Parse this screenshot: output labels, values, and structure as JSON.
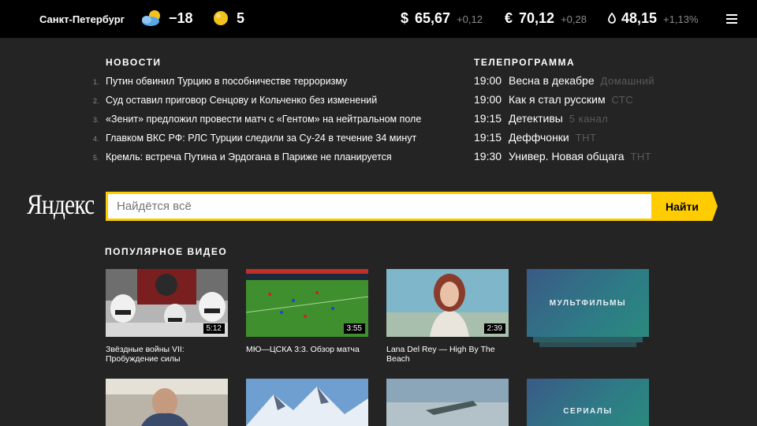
{
  "header": {
    "city": "Санкт-Петербург",
    "temperature": "−18",
    "traffic_score": "5",
    "rates": [
      {
        "symbol": "$",
        "value": "65,67",
        "change": "+0,12"
      },
      {
        "symbol": "€",
        "value": "70,12",
        "change": "+0,28"
      },
      {
        "symbol": "",
        "value": "48,15",
        "change": "+1,13%"
      }
    ],
    "weather_icon": "partly-cloudy-icon",
    "traffic_icon": "traffic-light-icon",
    "oil_icon": "oil-drop-icon",
    "menu_icon": "hamburger-menu-icon"
  },
  "news": {
    "title": "НОВОСТИ",
    "items": [
      {
        "num": "1.",
        "text": "Путин обвинил Турцию в пособничестве терроризму"
      },
      {
        "num": "2.",
        "text": "Суд оставил приговор Сенцову и Кольченко без изменений"
      },
      {
        "num": "3.",
        "text": "«Зенит» предложил провести матч с «Гентом» на нейтральном поле"
      },
      {
        "num": "4.",
        "text": "Главком ВКС РФ: РЛС Турции следили за Су-24 в течение 34 минут"
      },
      {
        "num": "5.",
        "text": "Кремль: встреча Путина и Эрдогана в Париже не планируется"
      }
    ]
  },
  "tv": {
    "title": "ТЕЛЕПРОГРАММА",
    "items": [
      {
        "time": "19:00",
        "show": "Весна в декабре",
        "channel": "Домашний"
      },
      {
        "time": "19:00",
        "show": "Как я стал русским",
        "channel": "СТС"
      },
      {
        "time": "19:15",
        "show": "Детективы",
        "channel": "5 канал"
      },
      {
        "time": "19:15",
        "show": "Деффчонки",
        "channel": "ТНТ"
      },
      {
        "time": "19:30",
        "show": "Универ. Новая общага",
        "channel": "ТНТ"
      }
    ]
  },
  "search": {
    "logo": "Яндекс",
    "placeholder": "Найдётся всё",
    "button": "Найти"
  },
  "videos": {
    "title": "ПОПУЛЯРНОЕ ВИДЕО",
    "items": [
      {
        "caption": "Звёздные войны VII: Пробуждение силы",
        "duration": "5:12"
      },
      {
        "caption": "МЮ—ЦСКА 3:3. Обзор матча",
        "duration": "3:55"
      },
      {
        "caption": "Lana Del Rey — High By The Beach",
        "duration": "2:39"
      }
    ],
    "categories": [
      "МУЛЬТФИЛЬМЫ",
      "СЕРИАЛЫ"
    ]
  }
}
